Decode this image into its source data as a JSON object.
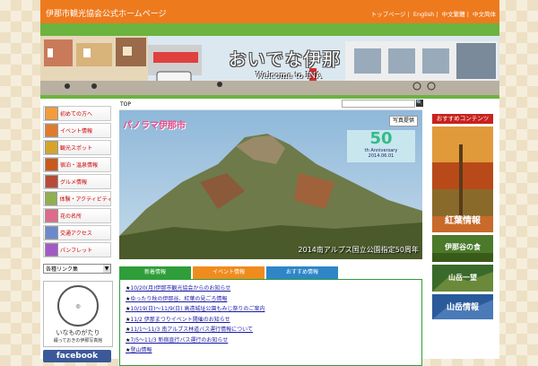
{
  "header": {
    "title": "伊那市観光協会公式ホームページ",
    "links": [
      "トップページ",
      "English",
      "中文繁體",
      "中文简体"
    ]
  },
  "banner": {
    "title": "おいでな伊那",
    "subtitle": "Welcome to INA"
  },
  "sidebar": {
    "items": [
      {
        "label": "初めての方へ",
        "color": "#f39c3c"
      },
      {
        "label": "イベント情報",
        "color": "#e07a2c"
      },
      {
        "label": "観光スポット",
        "color": "#d4a52a"
      },
      {
        "label": "宿泊・温泉情報",
        "color": "#c85a1e"
      },
      {
        "label": "グルメ情報",
        "color": "#b84a3a"
      },
      {
        "label": "体験・アクティビティ",
        "color": "#8fb04a"
      },
      {
        "label": "花の名所",
        "color": "#e06a8a"
      },
      {
        "label": "交通アクセス",
        "color": "#6a8acc"
      },
      {
        "label": "パンフレット",
        "color": "#a25ac4"
      }
    ],
    "select_value": "各種リンク集",
    "logo_text": "いなものがたり",
    "logo_sub": "綴っておきの伊那写真館",
    "facebook": "facebook"
  },
  "main": {
    "breadcrumb": "TOP",
    "photo_logo": "パノラマ伊那市",
    "photo_tag": "写真提供",
    "anniversary": {
      "number": "50",
      "text": "th Anniversary",
      "date": "2014.06.01"
    },
    "caption": "2014南アルプス国立公園指定50周年",
    "tabs": [
      "新着情報",
      "イベント情報",
      "おすすめ情報"
    ],
    "news": [
      "10/20(月)伊那市観光協会からのお知らせ",
      "ゆったり秋の伊那谷、紅葉の見ごろ情報",
      "10/19(日)〜11/9(日) 高遠城址公園もみじ祭りのご案内",
      "11/2 伊那まつりイベント開催のお知らせ",
      "11/1〜11/3 南アルプス林道バス運行情報について",
      "7/5〜11/3 新宿直行バス運行のお知らせ",
      "登山情報"
    ]
  },
  "right": {
    "heading": "おすすめコンテンツ",
    "ads": [
      "紅葉情報",
      "伊那谷の食",
      "山岳一望",
      "山岳情報"
    ]
  }
}
